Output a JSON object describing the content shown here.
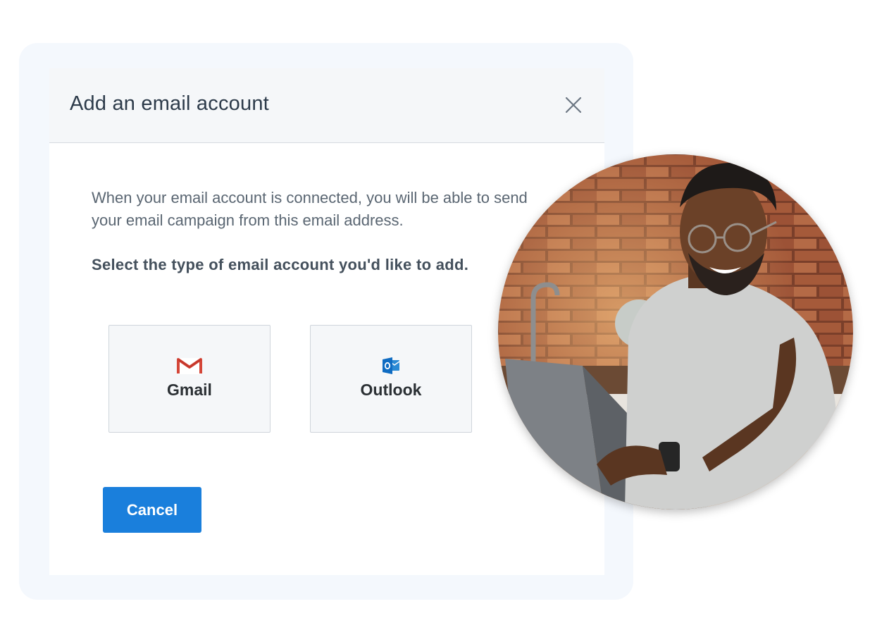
{
  "modal": {
    "title": "Add an email account",
    "description": "When your email account is connected, you will be able to send your email campaign from this email address.",
    "prompt": "Select the type of email account you'd like to add.",
    "options": [
      {
        "label": "Gmail",
        "icon": "gmail-icon"
      },
      {
        "label": "Outlook",
        "icon": "outlook-icon"
      }
    ],
    "cancel_label": "Cancel",
    "close_icon": "close-icon"
  },
  "photo": {
    "subject": "smiling-man-using-laptop-photo"
  },
  "colors": {
    "primary_button": "#1a7fdc",
    "header_bg": "#f5f7f9",
    "frame_bg": "#f4f8fd",
    "gmail_red": "#d44638",
    "outlook_blue": "#0f6cc2"
  }
}
